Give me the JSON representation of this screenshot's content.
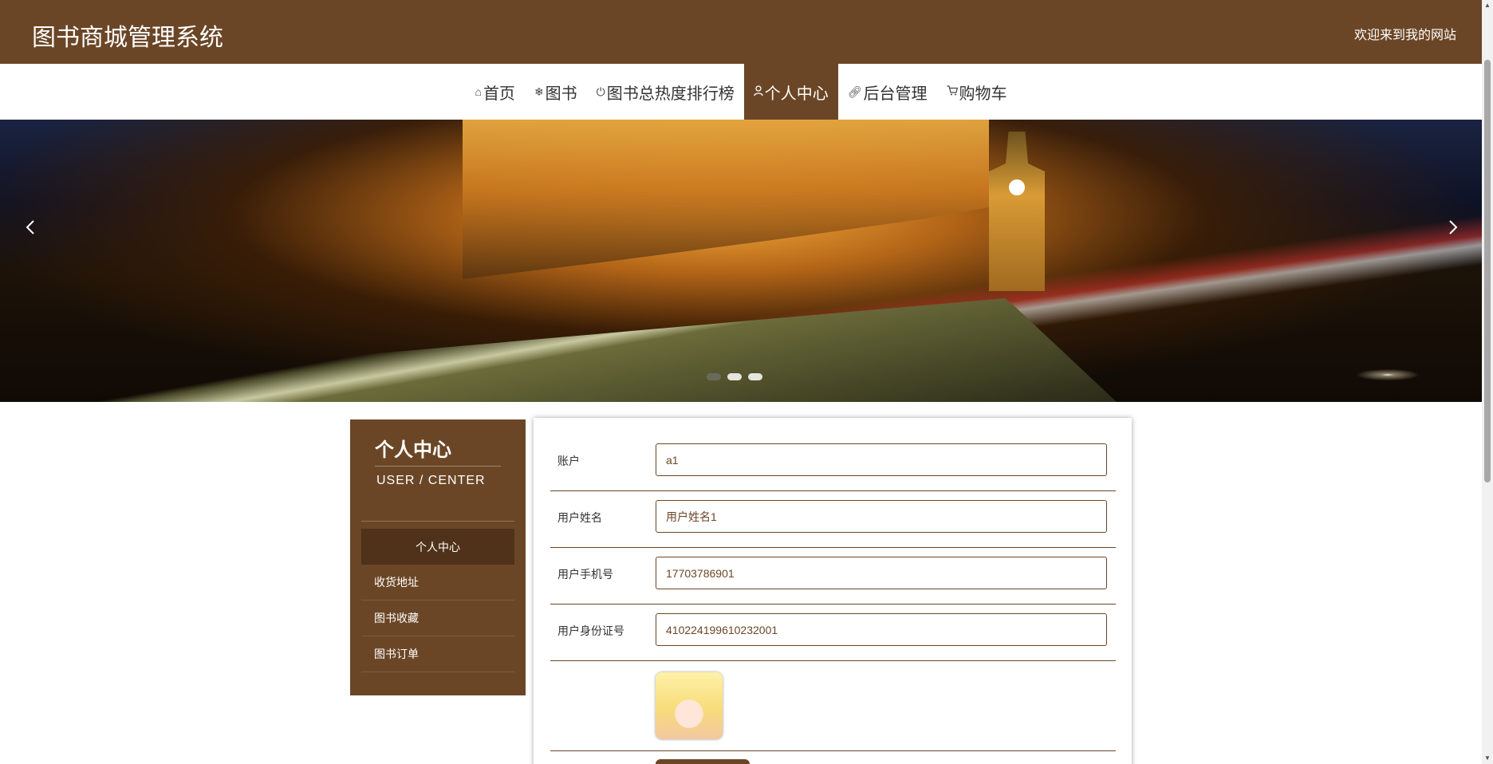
{
  "header": {
    "title": "图书商城管理系统",
    "welcome": "欢迎来到我的网站"
  },
  "nav": {
    "items": [
      {
        "icon": "home-icon",
        "label": "首页"
      },
      {
        "icon": "snowflake-icon",
        "label": "图书"
      },
      {
        "icon": "power-icon",
        "label": "图书总热度排行榜"
      },
      {
        "icon": "user-icon",
        "label": "个人中心"
      },
      {
        "icon": "link-icon",
        "label": "后台管理"
      },
      {
        "icon": "cart-icon",
        "label": "购物车"
      }
    ],
    "active": "个人中心"
  },
  "banner": {
    "slides": 3,
    "active_slide": 1
  },
  "sidebar": {
    "title": "个人中心",
    "subtitle": "USER / CENTER",
    "items": [
      {
        "label": "个人中心"
      },
      {
        "label": "收货地址"
      },
      {
        "label": "图书收藏"
      },
      {
        "label": "图书订单"
      }
    ]
  },
  "form": {
    "fields": [
      {
        "label": "账户",
        "value": "a1"
      },
      {
        "label": "用户姓名",
        "value": "用户姓名1"
      },
      {
        "label": "用户手机号",
        "value": "17703786901"
      },
      {
        "label": "用户身份证号",
        "value": "410224199610232001"
      }
    ]
  },
  "colors": {
    "brand": "#6b4626",
    "brand_dark": "#4f3219"
  }
}
